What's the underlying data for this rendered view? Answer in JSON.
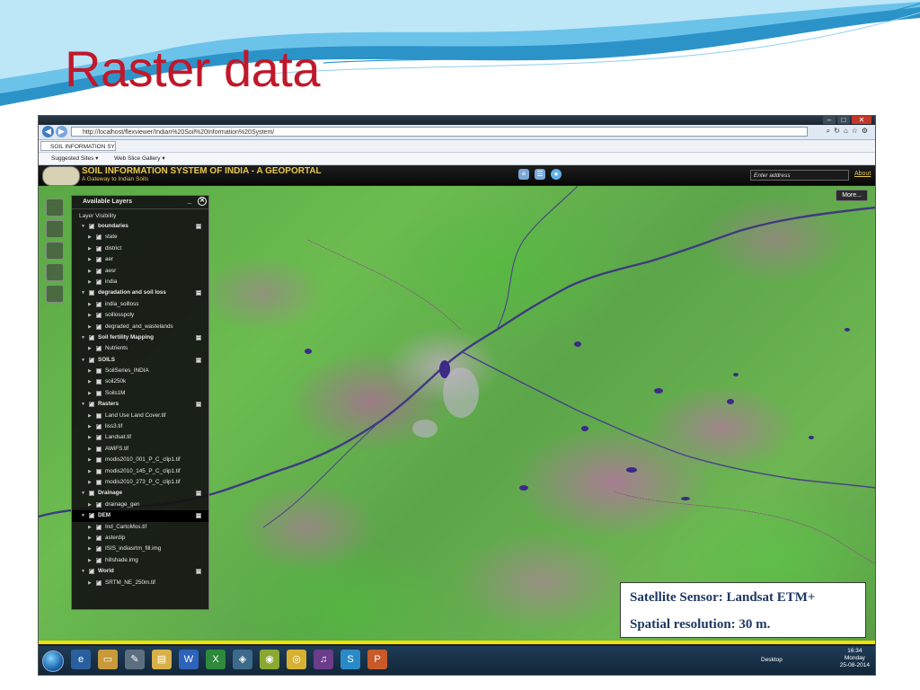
{
  "slide": {
    "title": "Raster data"
  },
  "browser": {
    "url": "http://localhost/flexviewer/Indian%20Soil%20Information%20System/",
    "tab_label": "SOIL INFORMATION SYST...",
    "favorites": [
      "Suggested Sites ▾",
      "Web Slice Gallery ▾"
    ]
  },
  "portal": {
    "title": "SOIL INFORMATION SYSTEM OF INDIA - A GEOPORTAL",
    "subtitle": "A Gateway to Indian Soils",
    "address_placeholder": "Enter address",
    "about_label": "About",
    "more_label": "More..."
  },
  "layers_panel": {
    "title": "Available Layers",
    "visibility_label": "Layer Visibility",
    "rows": [
      {
        "name": "boundaries",
        "group": true,
        "checked": true
      },
      {
        "name": "state",
        "group": false,
        "checked": true
      },
      {
        "name": "district",
        "group": false,
        "checked": true
      },
      {
        "name": "aer",
        "group": false,
        "checked": true
      },
      {
        "name": "aesr",
        "group": false,
        "checked": true
      },
      {
        "name": "india",
        "group": false,
        "checked": true
      },
      {
        "name": "degradation and soil loss",
        "group": true,
        "checked": false
      },
      {
        "name": "india_soilloss",
        "group": false,
        "checked": true
      },
      {
        "name": "soillosspoly",
        "group": false,
        "checked": true
      },
      {
        "name": "degraded_and_wastelands",
        "group": false,
        "checked": true
      },
      {
        "name": "Soil fertility Mapping",
        "group": true,
        "checked": true
      },
      {
        "name": "Nutrients",
        "group": false,
        "checked": true
      },
      {
        "name": "SOILS",
        "group": true,
        "checked": true
      },
      {
        "name": "SoilSeries_INDIA",
        "group": false,
        "checked": false
      },
      {
        "name": "soil250k",
        "group": false,
        "checked": false
      },
      {
        "name": "Soils1M",
        "group": false,
        "checked": false
      },
      {
        "name": "Rasters",
        "group": true,
        "checked": true
      },
      {
        "name": "Land Use Land Cover.tif",
        "group": false,
        "checked": false
      },
      {
        "name": "liss3.tif",
        "group": false,
        "checked": true
      },
      {
        "name": "Landsat.tif",
        "group": false,
        "checked": true
      },
      {
        "name": "AWiFS.tif",
        "group": false,
        "checked": false
      },
      {
        "name": "modis2010_001_P_C_clip1.tif",
        "group": false,
        "checked": false
      },
      {
        "name": "modis2010_145_P_C_clip1.tif",
        "group": false,
        "checked": false
      },
      {
        "name": "modis2010_273_P_C_clip1.tif",
        "group": false,
        "checked": false
      },
      {
        "name": "Drainage",
        "group": true,
        "checked": false
      },
      {
        "name": "drainage_gen",
        "group": false,
        "checked": true
      },
      {
        "name": "DEM",
        "group": true,
        "checked": true,
        "selected": true
      },
      {
        "name": "Ind_CartoMos.tif",
        "group": false,
        "checked": true
      },
      {
        "name": "asterdip",
        "group": false,
        "checked": true
      },
      {
        "name": "ISIS_indiasrtm_fill.img",
        "group": false,
        "checked": true
      },
      {
        "name": "hillshade.img",
        "group": false,
        "checked": true
      },
      {
        "name": "World",
        "group": true,
        "checked": true
      },
      {
        "name": "SRTM_NE_250m.tif",
        "group": false,
        "checked": true
      }
    ]
  },
  "taskbar": {
    "desktop_label": "Desktop",
    "time": "16:34",
    "day": "Monday",
    "date": "25-08-2014"
  },
  "info_box": {
    "line1": "Satellite Sensor: Landsat ETM+",
    "line2": "Spatial resolution: 30 m."
  },
  "colors": {
    "title_red": "#c0182a",
    "portal_gold": "#e8c84a",
    "info_text": "#1f3864",
    "vegetation_green": "#6cbc50",
    "soil_magenta": "#b86ea8",
    "river_purple": "#4a3a8a"
  }
}
